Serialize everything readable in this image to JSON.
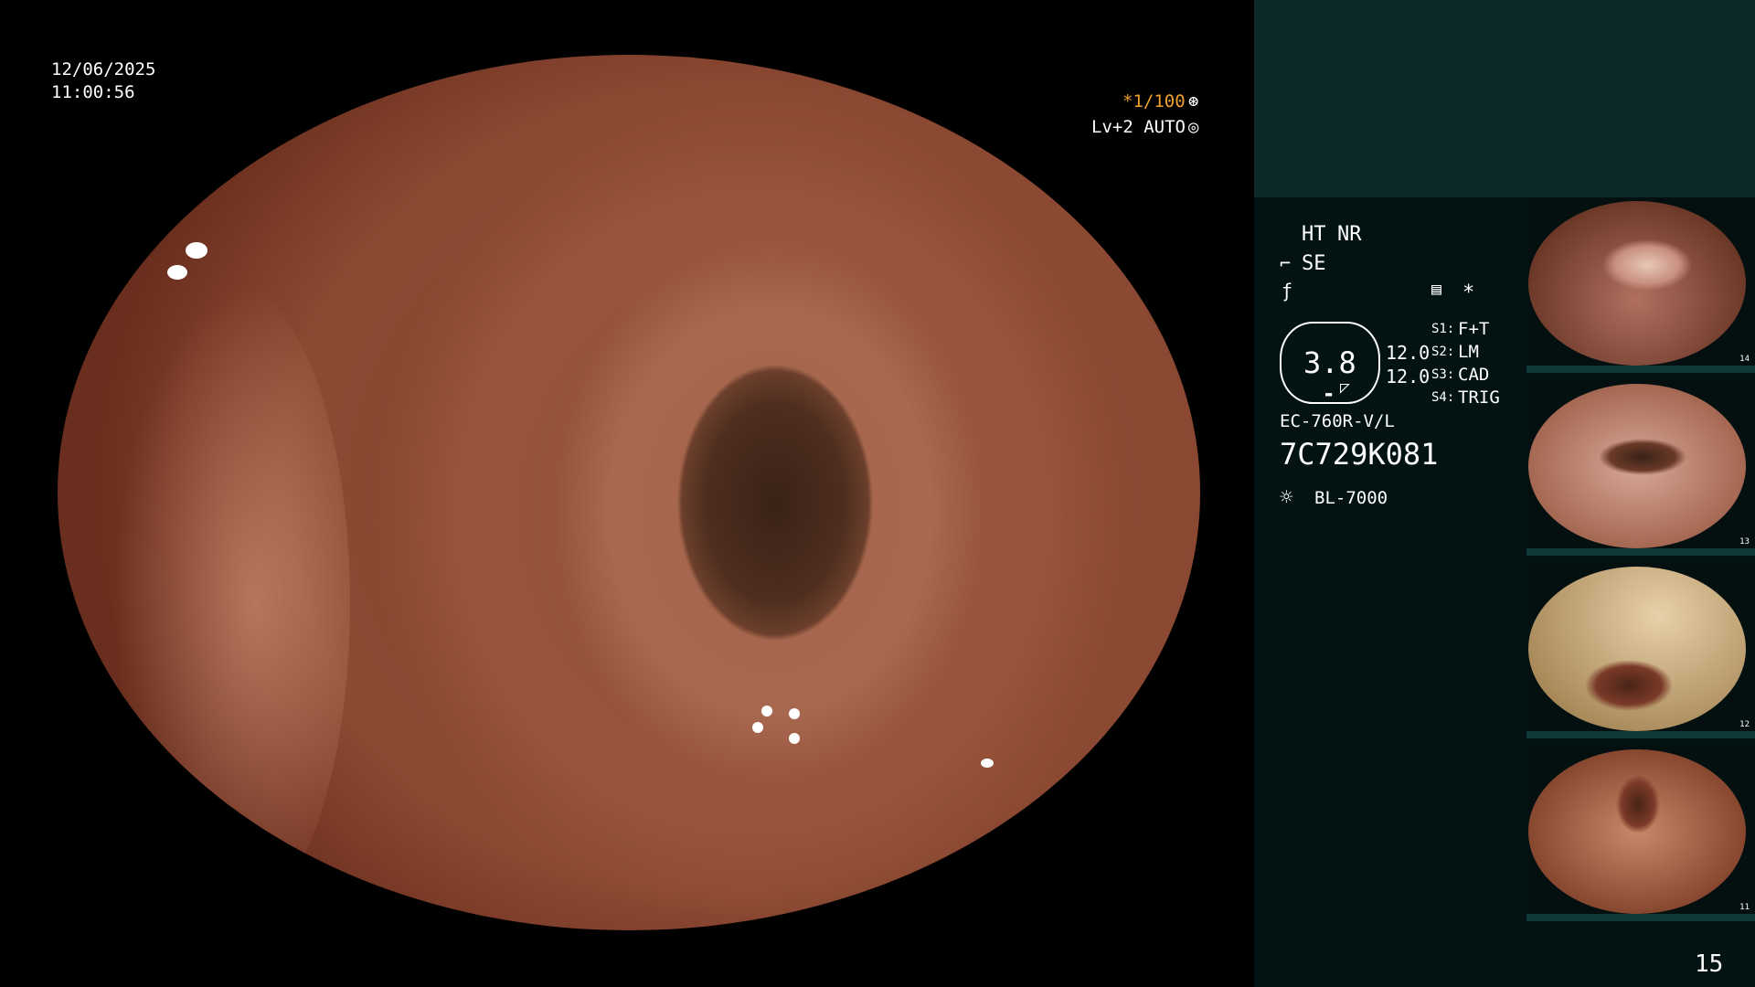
{
  "overlay": {
    "date": "12/06/2025",
    "time": "11:00:56",
    "shutter": "*1/100",
    "level": "Lv+2 AUTO"
  },
  "panel": {
    "ht": "HT",
    "nr": "NR",
    "se": "SE",
    "dial_value": "3.8",
    "val1": "12.0",
    "val2": "12.0",
    "switches": [
      {
        "key": "S1:",
        "label": "F+T"
      },
      {
        "key": "S2:",
        "label": "LM"
      },
      {
        "key": "S3:",
        "label": "CAD"
      },
      {
        "key": "S4:",
        "label": "TRIG"
      }
    ],
    "scope_model": "EC-760R-V/L",
    "serial": "7C729K081",
    "light_source": "BL-7000",
    "page_number": "15"
  },
  "thumbnails": [
    {
      "number": "14"
    },
    {
      "number": "13"
    },
    {
      "number": "12"
    },
    {
      "number": "11"
    }
  ],
  "colors": {
    "accent_orange": "#f0a030",
    "panel_bg": "#031313",
    "panel_top_bg": "#0d2828"
  }
}
